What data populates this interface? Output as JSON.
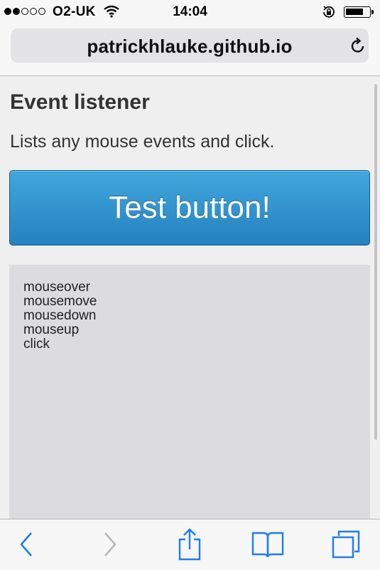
{
  "status_bar": {
    "carrier": "O2-UK",
    "time": "14:04",
    "signal_bars_filled": 2,
    "signal_bars_total": 5,
    "icons": [
      "wifi-icon",
      "rotation-lock-icon",
      "battery-icon"
    ]
  },
  "browser": {
    "url": "patrickhlauke.github.io",
    "reload_icon": "reload-icon"
  },
  "page": {
    "title": "Event listener",
    "description": "Lists any mouse events and click.",
    "button_label": "Test button!",
    "button_color": "#2f8fd0",
    "log": [
      "mouseover",
      "mousemove",
      "mousedown",
      "mouseup",
      "click"
    ]
  },
  "toolbar": {
    "items": [
      "back-icon",
      "forward-icon",
      "share-icon",
      "bookmarks-icon",
      "tabs-icon"
    ],
    "accent": "#1f7cf0",
    "disabled": "#b8b8bc"
  }
}
